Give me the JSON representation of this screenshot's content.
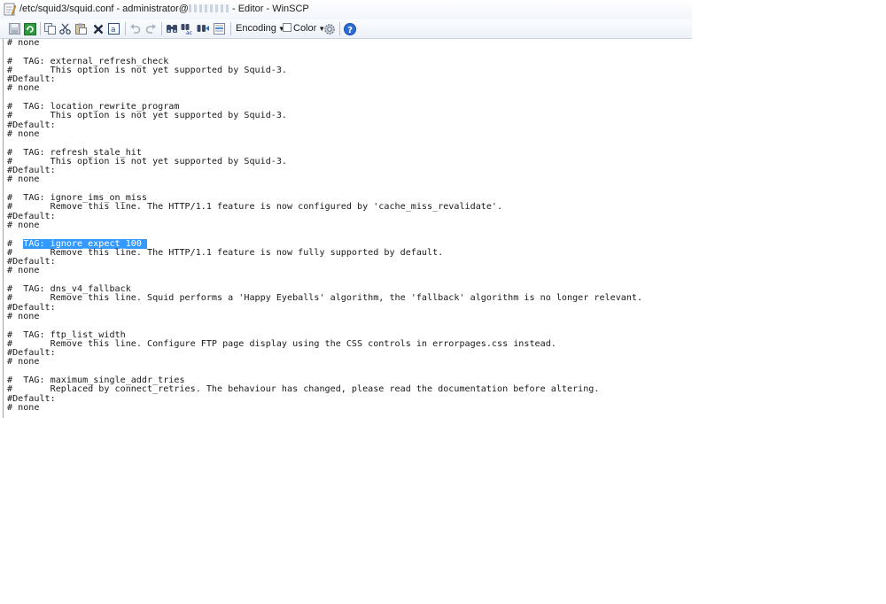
{
  "window": {
    "title_prefix": "/etc/squid3/squid.conf - administrator@",
    "title_suffix": " - Editor - WinSCP"
  },
  "toolbar": {
    "buttons": [
      {
        "icon": "save-icon"
      },
      {
        "icon": "reload-icon"
      },
      {
        "icon": "copy-icon"
      },
      {
        "icon": "cut-icon"
      },
      {
        "icon": "paste-icon"
      },
      {
        "icon": "delete-icon"
      },
      {
        "icon": "select-all-icon"
      },
      {
        "icon": "undo-icon"
      },
      {
        "icon": "redo-icon"
      },
      {
        "icon": "find-icon"
      },
      {
        "icon": "replace-icon"
      },
      {
        "icon": "find-next-icon"
      },
      {
        "icon": "goto-line-icon"
      },
      {
        "icon": "settings-icon"
      },
      {
        "icon": "help-icon"
      }
    ],
    "encoding_label": "Encoding",
    "color_label": "Color",
    "color_checked": false
  },
  "colors": {
    "selection": "#3399ff",
    "gutter": "#8fa6c4",
    "help": "#2b6cd6"
  },
  "editor": {
    "lines": [
      "# none",
      "",
      "#  TAG: external_refresh_check",
      "#       This option is not yet supported by Squid-3.",
      "#Default:",
      "# none",
      "",
      "#  TAG: location_rewrite_program",
      "#       This option is not yet supported by Squid-3.",
      "#Default:",
      "# none",
      "",
      "#  TAG: refresh_stale_hit",
      "#       This option is not yet supported by Squid-3.",
      "#Default:",
      "# none",
      "",
      "#  TAG: ignore_ims_on_miss",
      "#       Remove this line. The HTTP/1.1 feature is now configured by 'cache_miss_revalidate'.",
      "#Default:",
      "# none",
      "",
      "#  TAG: ignore_expect_100",
      "#       Remove this line. The HTTP/1.1 feature is now fully supported by default.",
      "#Default:",
      "# none",
      "",
      "#  TAG: dns_v4_fallback",
      "#       Remove this line. Squid performs a 'Happy Eyeballs' algorithm, the 'fallback' algorithm is no longer relevant.",
      "#Default:",
      "# none",
      "",
      "#  TAG: ftp_list_width",
      "#       Remove this line. Configure FTP page display using the CSS controls in errorpages.css instead.",
      "#Default:",
      "# none",
      "",
      "#  TAG: maximum_single_addr_tries",
      "#       Replaced by connect_retries. The behaviour has changed, please read the documentation before altering.",
      "#Default:",
      "# none"
    ],
    "selection": {
      "line": 22,
      "prefix": "#  ",
      "text": "TAG: ignore_expect_100 "
    }
  }
}
